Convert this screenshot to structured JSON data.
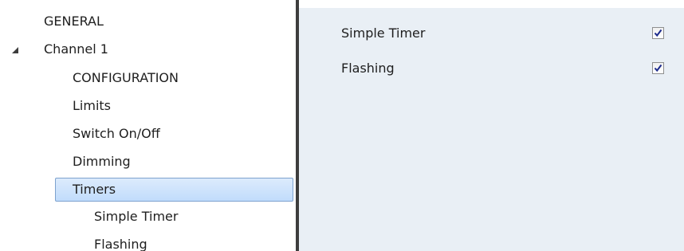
{
  "tree": {
    "items": [
      {
        "label": "GENERAL",
        "level": 0
      },
      {
        "label": "Channel 1",
        "level": 0,
        "expanded": true
      },
      {
        "label": "CONFIGURATION",
        "level": 1
      },
      {
        "label": "Limits",
        "level": 1
      },
      {
        "label": "Switch On/Off",
        "level": 1
      },
      {
        "label": "Dimming",
        "level": 1
      },
      {
        "label": "Timers",
        "level": 1,
        "selected": true
      },
      {
        "label": "Simple Timer",
        "level": 2
      },
      {
        "label": "Flashing",
        "level": 2
      }
    ]
  },
  "content": {
    "params": [
      {
        "label": "Simple Timer",
        "checked": true
      },
      {
        "label": "Flashing",
        "checked": true
      }
    ]
  },
  "colors": {
    "selection_fill": "#c9e0fc",
    "selection_border": "#7da2ce",
    "content_bg": "#e9eff5",
    "splitter": "#3d3d3d",
    "check_mark": "#1c2a8c"
  }
}
